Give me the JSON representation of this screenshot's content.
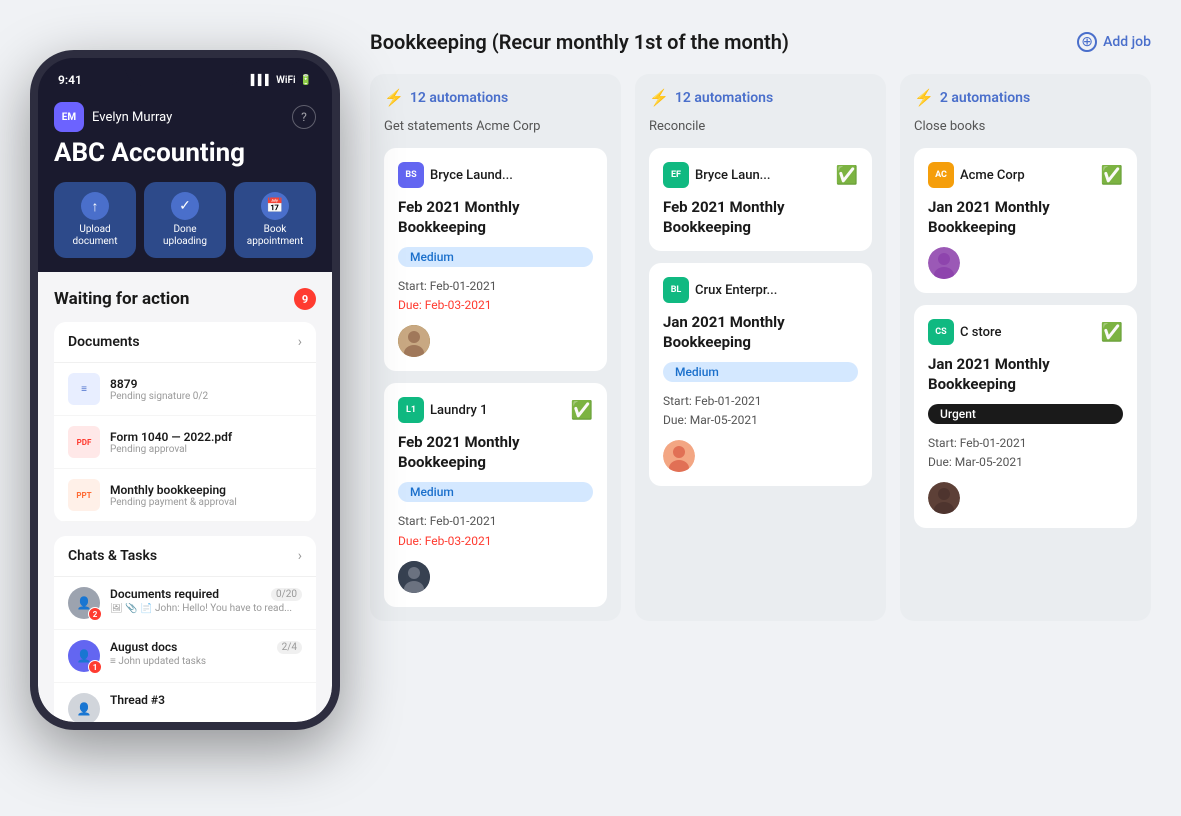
{
  "app": {
    "title": "Bookkeeping (Recur monthly 1st of the month)"
  },
  "header": {
    "title": "Bookkeeping (Recur monthly 1st of the month)",
    "add_job_label": "Add job"
  },
  "phone": {
    "status_bar": {
      "time": "9:41"
    },
    "user": {
      "initials": "EM",
      "name": "Evelyn Murray"
    },
    "company": "ABC Accounting",
    "action_buttons": [
      {
        "icon": "↑",
        "label": "Upload\ndocument"
      },
      {
        "icon": "✓",
        "label": "Done\nuploading"
      },
      {
        "icon": "📅",
        "label": "Book\nappointment"
      }
    ],
    "waiting_section": {
      "title": "Waiting for action",
      "count": "9"
    },
    "documents_section": {
      "title": "Documents",
      "items": [
        {
          "name": "8879",
          "status": "Pending signature 0/2",
          "icon_type": "blue",
          "icon_text": "≡"
        },
        {
          "name": "Form 1040 — 2022.pdf",
          "status": "Pending approval",
          "icon_type": "red",
          "icon_text": "PDF"
        },
        {
          "name": "Monthly bookkeeping",
          "status": "Pending payment & approval",
          "icon_type": "orange",
          "icon_text": "PPT"
        }
      ]
    },
    "chats_section": {
      "title": "Chats & Tasks",
      "items": [
        {
          "title": "Documents required",
          "count": "0/20",
          "preview": "John: Hello! You have to read...",
          "badge": "2",
          "icons": "🖼 📎 📄"
        },
        {
          "title": "August docs",
          "count": "2/4",
          "preview": "John updated tasks",
          "badge": "1",
          "icons": "≡"
        },
        {
          "title": "Thread #3",
          "badge": ""
        }
      ]
    }
  },
  "columns": [
    {
      "automations": "12 automations",
      "subtitle": "Get statements Acme Corp",
      "cards": [
        {
          "client_initials": "BS",
          "client_color": "#6366f1",
          "client_name": "Bryce Laund...",
          "checked": false,
          "title": "Feb 2021 Monthly Bookkeeping",
          "priority": "Medium",
          "priority_type": "medium",
          "start": "Start: Feb-01-2021",
          "due": "Due: Feb-03-2021",
          "due_overdue": true,
          "assignee_type": "face1"
        },
        {
          "client_initials": "L1",
          "client_color": "#10b981",
          "client_name": "Laundry 1",
          "checked": true,
          "title": "Feb 2021 Monthly Bookkeeping",
          "priority": "Medium",
          "priority_type": "medium",
          "start": "Start: Feb-01-2021",
          "due": "Due: Feb-03-2021",
          "due_overdue": true,
          "assignee_type": "face2"
        }
      ]
    },
    {
      "automations": "12 automations",
      "subtitle": "Reconcile",
      "cards": [
        {
          "client_initials": "EF",
          "client_color": "#10b981",
          "client_name": "Bryce Laun...",
          "checked": true,
          "title": "Feb 2021 Monthly Bookkeeping",
          "priority": null,
          "priority_type": null,
          "start": null,
          "due": null,
          "due_overdue": false,
          "assignee_type": null
        },
        {
          "client_initials": "BL",
          "client_color": "#10b981",
          "client_name": "Crux Enterpr...",
          "checked": false,
          "title": "Jan 2021 Monthly Bookkeeping",
          "priority": "Medium",
          "priority_type": "medium",
          "start": "Start: Feb-01-2021",
          "due": "Due: Mar-05-2021",
          "due_overdue": false,
          "assignee_type": "face3"
        }
      ]
    },
    {
      "automations": "2 automations",
      "subtitle": "Close books",
      "cards": [
        {
          "client_initials": "AC",
          "client_color": "#f59e0b",
          "client_name": "Acme Corp",
          "checked": true,
          "title": "Jan 2021 Monthly Bookkeeping",
          "priority": null,
          "priority_type": null,
          "start": null,
          "due": null,
          "due_overdue": false,
          "assignee_type": "face4"
        },
        {
          "client_initials": "CS",
          "client_color": "#10b981",
          "client_name": "C store",
          "checked": true,
          "title": "Jan 2021 Monthly Bookkeeping",
          "priority": "Urgent",
          "priority_type": "urgent",
          "start": "Start: Feb-01-2021",
          "due": "Due: Mar-05-2021",
          "due_overdue": false,
          "assignee_type": "face5"
        }
      ]
    }
  ]
}
